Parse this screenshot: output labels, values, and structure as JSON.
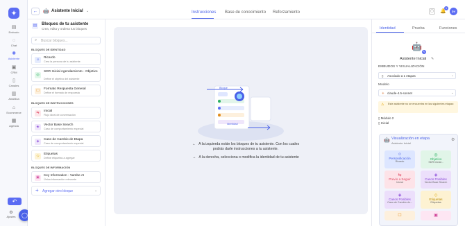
{
  "nav": {
    "items": [
      {
        "label": "Embudo"
      },
      {
        "label": "Chat"
      },
      {
        "label": "Asistente"
      },
      {
        "label": "CRM"
      },
      {
        "label": "Canales"
      },
      {
        "label": "Analítica"
      },
      {
        "label": "Ecommerce"
      },
      {
        "label": "Agenda"
      }
    ],
    "bottom_label": "Ajustes"
  },
  "header": {
    "assistant_name": "Asistente Inicial",
    "tabs": [
      "Instrucciones",
      "Base de conocimiento",
      "Reforzamiento"
    ],
    "notif_count": "1",
    "avatar": "DV"
  },
  "blocks": {
    "title": "Bloques de tu asistente",
    "subtitle": "Crea, edita y ordena tus bloques",
    "search_placeholder": "Buscar bloques...",
    "sections": [
      {
        "title": "BLOQUES DE IDENTIDAD",
        "cards": [
          {
            "title": "Ricardo",
            "sub": "Crea la persona de tu asistente"
          },
          {
            "title": "SDR Inicial Agendamiento - Objetivo",
            "sub": "Define el objetivo del asistente"
          },
          {
            "title": "Formato Respuesta General",
            "sub": "Define el formato de respuesta"
          }
        ]
      },
      {
        "title": "BLOQUES DE INSTRUCCIONES",
        "cards": [
          {
            "title": "Inicial",
            "sub": "Flujo ideal de conversación"
          },
          {
            "title": "Vector Base Search",
            "sub": "Caso de comportamiento especial"
          },
          {
            "title": "Caso de Cambio de Etapa",
            "sub": "Caso de comportamiento especial"
          },
          {
            "title": "Etiquetas",
            "sub": "Define etiquetas a agregar"
          }
        ]
      },
      {
        "title": "BLOQUES DE INFORMACIÓN",
        "cards": [
          {
            "title": "Key Information - Vambe AI",
            "sub": "Única información relevante"
          }
        ]
      }
    ],
    "add_label": "Agregar otro bloque"
  },
  "canvas": {
    "diagram_labels": {
      "top": "Bloque",
      "bottom": "Identidad"
    },
    "help_left": "A la izquierda están los bloques de tu asistente. Con los cuales podrás darle instrucciones a tu asistente.",
    "help_right": "A la derecha, selecciona o modifica la identidad de tu asistente"
  },
  "right": {
    "tabs": [
      "Identidad",
      "Prueba",
      "Funciones"
    ],
    "assistant_name": "Asistente Inicial",
    "funnels_label": "EMBUDOS Y VISUALIZACIÓN",
    "funnels_value": "Asociado a 1 etapas",
    "model_label": "Modelo",
    "model_value": "claude-4.5-sonnet",
    "warning": "Este asistente no se encuentra en las siguientes etapas:",
    "modules": [
      "Módulo 2",
      "Inicial"
    ],
    "viz": {
      "title": "Visualización en etapa",
      "sub": "Asistente Inicial",
      "tiles": [
        {
          "label": "Personificación",
          "sub": "Ricardo"
        },
        {
          "label": "Objetivo",
          "sub": "SDR Inicial..."
        },
        {
          "label": "Previo a Seguir",
          "sub": "Inicial"
        },
        {
          "label": "Casos Posibles",
          "sub": "Vector Base Search"
        },
        {
          "label": "Casos Posibles",
          "sub": "Caso de Cambio de..."
        },
        {
          "label": "Etiquetas",
          "sub": "Etiquetas"
        }
      ]
    }
  },
  "colors": {
    "accent": "#5b6cf3",
    "canvas_bg": "#eef0f7"
  }
}
